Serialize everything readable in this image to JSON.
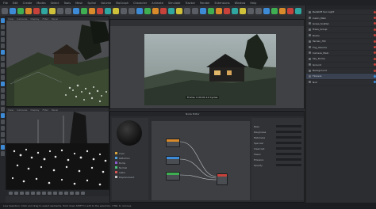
{
  "menu": [
    "File",
    "Edit",
    "Create",
    "Modes",
    "Select",
    "Tools",
    "Mesh",
    "Spline",
    "Volume",
    "MoGraph",
    "Character",
    "Animate",
    "Simulate",
    "Tracker",
    "Render",
    "Extensions",
    "Window",
    "Help"
  ],
  "colors": {
    "accent_blue": "#3d8bd6",
    "green": "#3fae52",
    "orange": "#d98a2b",
    "red": "#c7423a",
    "teal": "#2fa6a0",
    "yellow": "#cfc13a"
  },
  "render_view": {
    "caption": "Frame: 0  00:01:12  Cycles"
  },
  "node_editor": {
    "title": "Node Editor",
    "material_channels": [
      {
        "label": "Color",
        "color": "#d6a33a"
      },
      {
        "label": "Reflection",
        "color": "#4fa0d8"
      },
      {
        "label": "Bump",
        "color": "#8c5bd1"
      },
      {
        "label": "Normal",
        "color": "#4cc07a"
      },
      {
        "label": "Alpha",
        "color": "#d65454"
      },
      {
        "label": "Displacement",
        "color": "#c2c2c2"
      }
    ]
  },
  "attributes": {
    "rows": [
      "Base",
      "Roughness",
      "Metalness",
      "Specular",
      "Clearcoat",
      "Sheen",
      "Emission",
      "Opacity"
    ]
  },
  "objects": [
    {
      "name": "Redshift Sun Light",
      "tag": "#c7423a"
    },
    {
      "name": "Cabin_Main",
      "tag": "#c7423a"
    },
    {
      "name": "Grass_Scatter",
      "tag": "#c7423a"
    },
    {
      "name": "Trees_Group",
      "tag": "#c7423a"
    },
    {
      "name": "Rocks",
      "tag": "#c7423a"
    },
    {
      "name": "Terrain_Hill",
      "tag": "#c7423a"
    },
    {
      "name": "Fog_Volume",
      "tag": "#c7423a"
    },
    {
      "name": "Camera_Main",
      "tag": "#c7423a"
    },
    {
      "name": "Sky_Dome",
      "tag": "#c7423a"
    },
    {
      "name": "Ground",
      "tag": "#c7423a"
    },
    {
      "name": "Background",
      "tag": "#c7423a"
    },
    {
      "name": "Flowers",
      "tag": "#3d8bd6"
    },
    {
      "name": "Null",
      "tag": "#3d8bd6"
    }
  ],
  "status": {
    "text": "Live Selection: Click and drag to select elements. Hold down SHIFT to add to the selection, CTRL to remove."
  }
}
